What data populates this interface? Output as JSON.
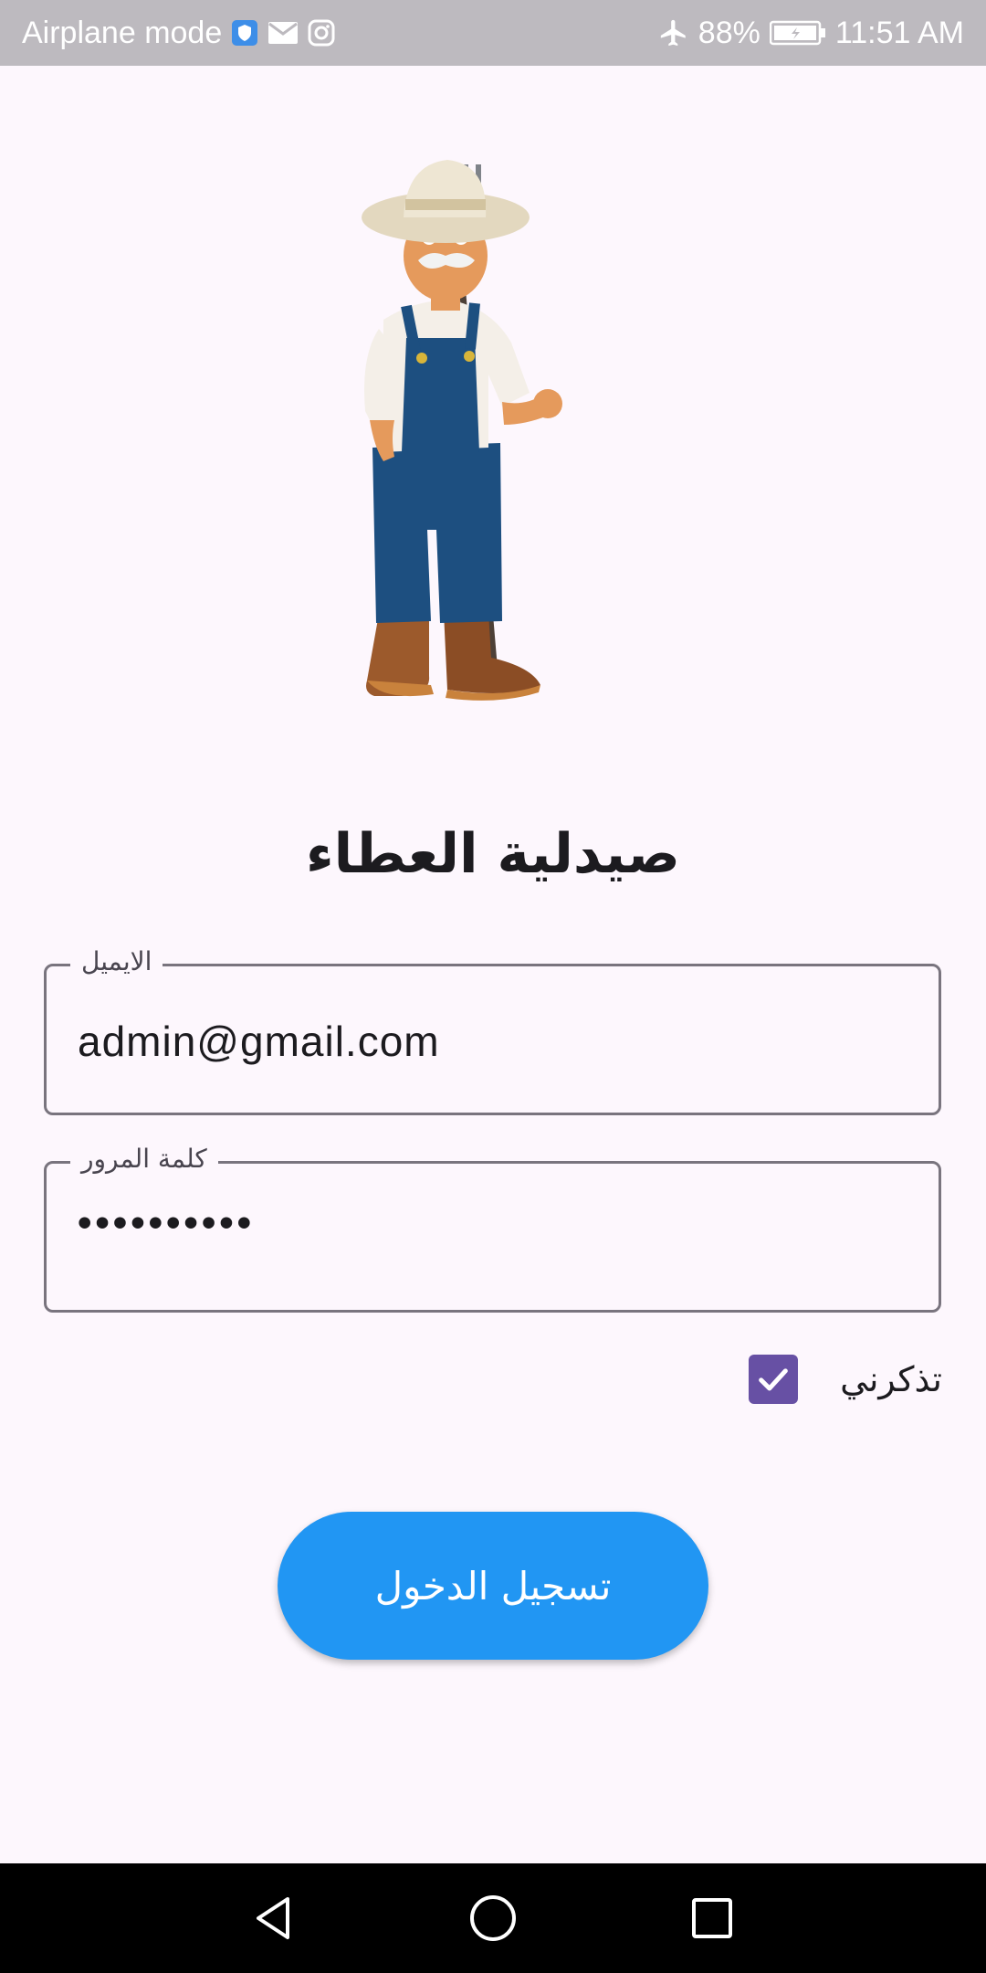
{
  "status_bar": {
    "airplane_label": "Airplane mode",
    "battery": "88%",
    "time": "11:51 AM",
    "icons": [
      "shield-icon",
      "mail-icon",
      "instagram-icon",
      "airplane-icon",
      "battery-icon"
    ]
  },
  "illustration": {
    "icon": "farmer-illustration"
  },
  "app_title": "صيدلية العطاء",
  "email_field": {
    "label": "الايميل",
    "value": "admin@gmail.com"
  },
  "password_field": {
    "label": "كلمة المرور",
    "value": "••••••••••"
  },
  "remember_me": {
    "label": "تذكرني",
    "checked": true
  },
  "login_button": {
    "label": "تسجيل الدخول"
  },
  "nav_bar": {
    "icons": [
      "back-icon",
      "home-icon",
      "recents-icon"
    ]
  },
  "colors": {
    "primary_button": "#2196f3",
    "checkbox": "#6750a4",
    "background": "#fdf7fd",
    "status_bar": "#bdbabf"
  }
}
